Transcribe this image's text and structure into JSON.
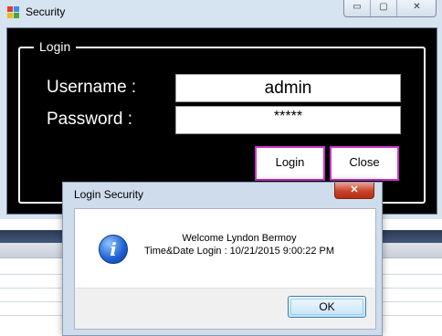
{
  "main_window": {
    "title": "Security",
    "controls": {
      "minimize": "▭",
      "maximize": "▢",
      "close": "✕"
    },
    "group_title": "Login",
    "username_label": "Username :",
    "username_value": "admin",
    "password_label": "Password :",
    "password_value": "*****",
    "login_button": "Login",
    "close_button": "Close"
  },
  "dialog": {
    "title": "Login Security",
    "close": "✕",
    "message_line1": "Welcome Lyndon Bermoy",
    "message_line2": "Time&Date Login : 10/21/2015 9:00:22 PM",
    "ok_button": "OK"
  },
  "colors": {
    "client_bg": "#000000",
    "button_border": "#cc33cc",
    "frame": "#d6e3f1"
  },
  "icons": [
    "app-icon",
    "info-icon",
    "minimize-icon",
    "maximize-icon",
    "close-icon"
  ]
}
